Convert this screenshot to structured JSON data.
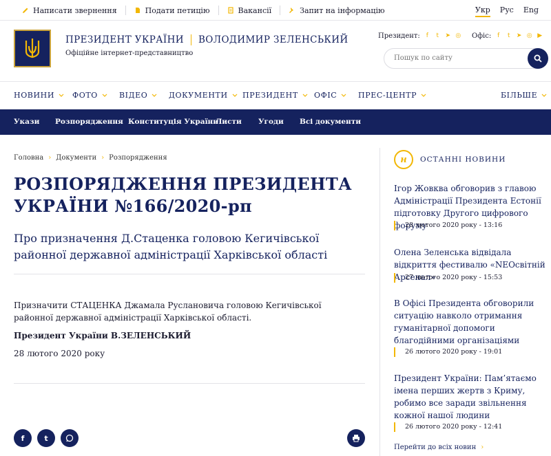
{
  "topbar": {
    "links": [
      {
        "label": "Написати звернення",
        "icon": "pencil-icon"
      },
      {
        "label": "Подати петицію",
        "icon": "document-icon"
      },
      {
        "label": "Вакансії",
        "icon": "file-icon"
      },
      {
        "label": "Запит на інформацію",
        "icon": "pin-icon"
      }
    ],
    "langs": [
      "Укр",
      "Рус",
      "Eng"
    ],
    "active_lang": "Укр"
  },
  "header": {
    "title_left": "ПРЕЗИДЕНТ УКРАЇНИ",
    "title_right": "ВОЛОДИМИР ЗЕЛЕНСЬКИЙ",
    "subtitle": "Офіційне інтернет-представництво",
    "president_label": "Президент:",
    "office_label": "Офіс:",
    "search_placeholder": "Пошук по сайту"
  },
  "nav": {
    "items": [
      "НОВИНИ",
      "ФОТО",
      "ВІДЕО",
      "ДОКУМЕНТИ",
      "ПРЕЗИДЕНТ",
      "ОФІС",
      "ПРЕС-ЦЕНТР"
    ],
    "more": "БІЛЬШЕ"
  },
  "subnav": {
    "items": [
      "Укази",
      "Розпорядження",
      "Конституція України",
      "Листи",
      "Угоди",
      "Всі документи"
    ]
  },
  "breadcrumbs": [
    "Головна",
    "Документи",
    "Розпорядження"
  ],
  "article": {
    "title": "РОЗПОРЯДЖЕННЯ ПРЕЗИДЕНТА УКРАЇНИ №166/2020-рп",
    "subtitle": "Про призначення Д.Стаценка головою Кегичівської районної державної адміністрації Харківської області",
    "body": "Призначити СТАЦЕНКА Джамала Руслановича головою Кегичівської районної державної адміністрації Харківської області.",
    "signature": "Президент України В.ЗЕЛЕНСЬКИЙ",
    "date": "28 лютого 2020 року"
  },
  "sidebar": {
    "badge": "н",
    "heading": "ОСТАННІ НОВИНИ",
    "news": [
      {
        "title": "Ігор Жовква обговорив з главою Адміністрації Президента Естонії підготовку Другого цифрового форуму",
        "date": "28 лютого 2020 року - 13:16"
      },
      {
        "title": "Олена Зеленська відвідала відкриття фестивалю «NEOсвітній Арсенал»",
        "date": "27 лютого 2020 року - 15:53"
      },
      {
        "title": "В Офісі Президента обговорили ситуацію навколо отримання гуманітарної допомоги благодійними організаціями",
        "date": "26 лютого 2020 року - 19:01"
      },
      {
        "title": "Президент України: Пам’ятаємо імена перших жертв з Криму, робимо все заради звільнення кожної нашої людини",
        "date": "26 лютого 2020 року - 12:41"
      }
    ],
    "all_news": "Перейти до всіх новин"
  },
  "colors": {
    "navy": "#15225e",
    "gold": "#f2b705"
  }
}
